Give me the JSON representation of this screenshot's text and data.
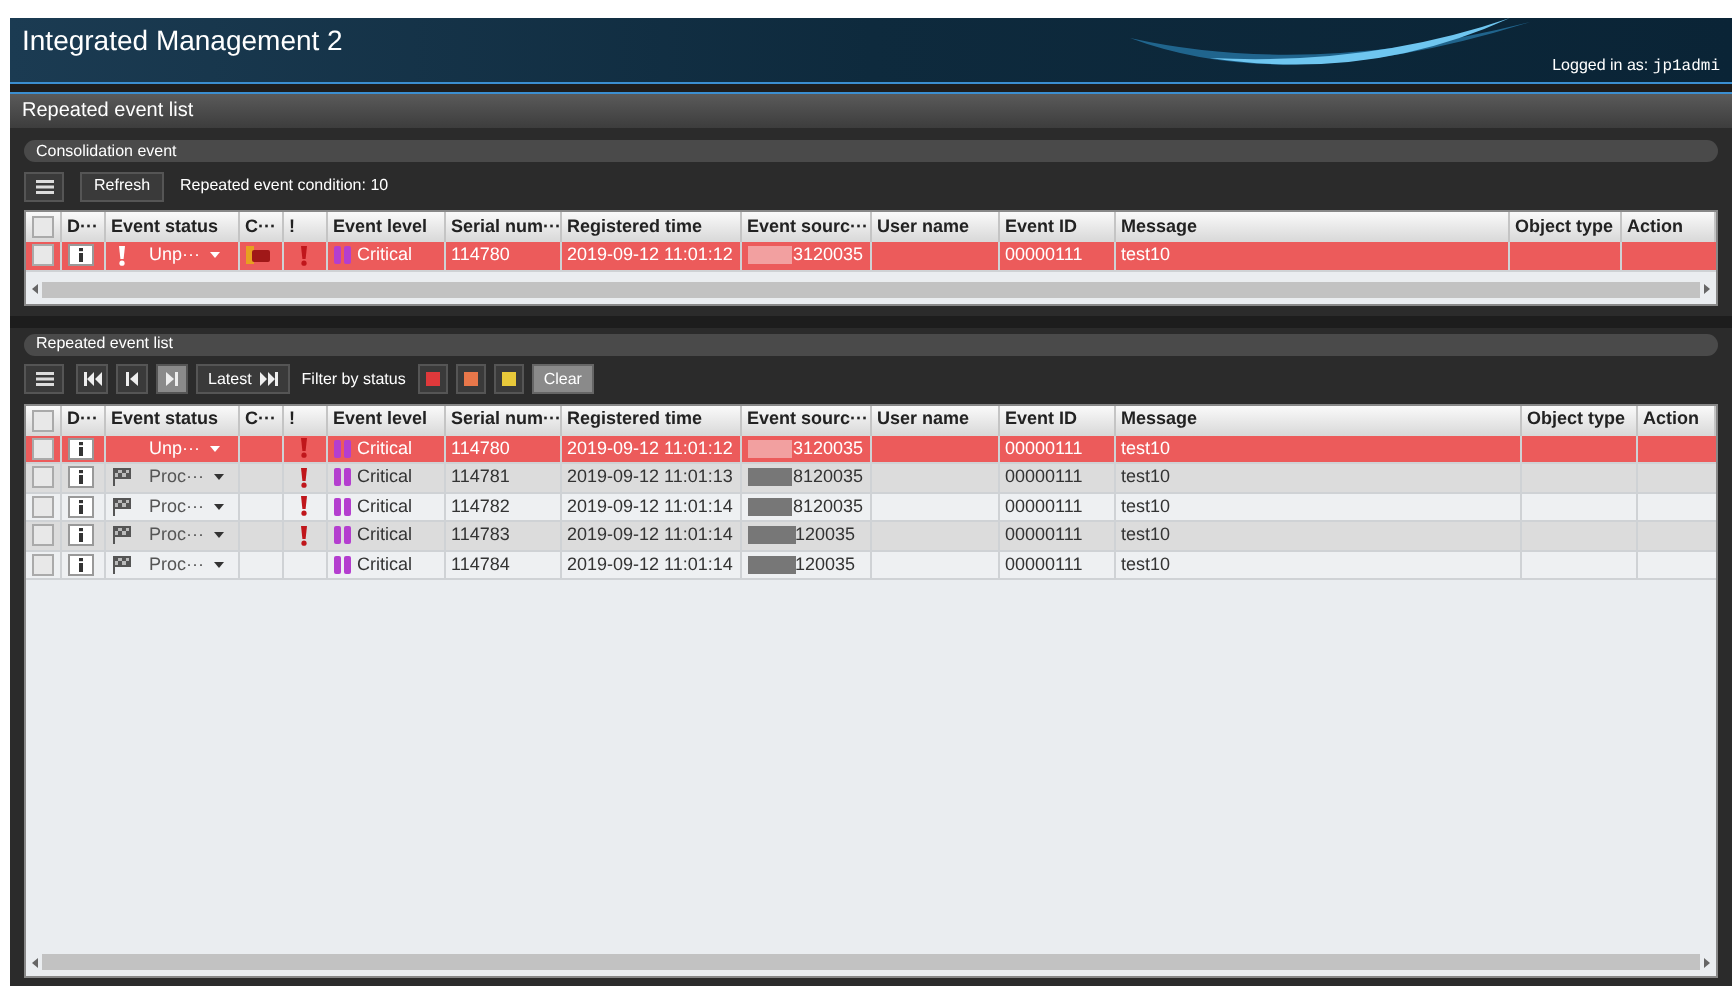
{
  "app_title": "Integrated Management 2",
  "login": {
    "label": "Logged in as:",
    "user": "jp1admi"
  },
  "panel_title": "Repeated event list",
  "consolidation": {
    "title": "Consolidation event",
    "refresh": "Refresh",
    "condition": "Repeated event condition: 10",
    "select_all_checked": false,
    "columns": [
      "D···",
      "Event status",
      "C···",
      "!",
      "Event level",
      "Serial num···",
      "Registered time",
      "Event sourc···",
      "User name",
      "Event ID",
      "Message",
      "Object type",
      "Action"
    ],
    "rows": [
      {
        "selected": true,
        "checked": false,
        "status": "Unp···",
        "alert": true,
        "flagged": false,
        "comment": true,
        "important": true,
        "level": "Critical",
        "serial": "114780",
        "time": "2019-09-12 11:01:12",
        "source": "3120035",
        "event_id": "00000111",
        "message": "test10"
      }
    ]
  },
  "repeated": {
    "title": "Repeated event list",
    "latest": "Latest",
    "filter_label": "Filter by status",
    "clear": "Clear",
    "select_all_checked": false,
    "nav": [
      {
        "kind": "first",
        "disabled": false
      },
      {
        "kind": "prev",
        "disabled": false
      },
      {
        "kind": "next",
        "disabled": true
      }
    ],
    "filters": [
      {
        "color": "#e0393b"
      },
      {
        "color": "#e8774a"
      },
      {
        "color": "#e8c93a"
      }
    ],
    "columns": [
      "D···",
      "Event status",
      "C···",
      "!",
      "Event level",
      "Serial num···",
      "Registered time",
      "Event sourc···",
      "User name",
      "Event ID",
      "Message",
      "Object type",
      "Action"
    ],
    "rows": [
      {
        "selected": true,
        "checked": false,
        "status": "Unp···",
        "alert": false,
        "flagged": false,
        "comment": false,
        "important": true,
        "level": "Critical",
        "serial": "114780",
        "time": "2019-09-12 11:01:12",
        "source": "3120035",
        "event_id": "00000111",
        "message": "test10"
      },
      {
        "selected": false,
        "checked": false,
        "status": "Proc···",
        "alert": false,
        "flagged": true,
        "comment": false,
        "important": true,
        "level": "Critical",
        "serial": "114781",
        "time": "2019-09-12 11:01:13",
        "source": "8120035",
        "event_id": "00000111",
        "message": "test10"
      },
      {
        "selected": false,
        "checked": false,
        "status": "Proc···",
        "alert": false,
        "flagged": true,
        "comment": false,
        "important": true,
        "level": "Critical",
        "serial": "114782",
        "time": "2019-09-12 11:01:14",
        "source": "8120035",
        "event_id": "00000111",
        "message": "test10"
      },
      {
        "selected": false,
        "checked": false,
        "status": "Proc···",
        "alert": false,
        "flagged": true,
        "comment": false,
        "important": true,
        "level": "Critical",
        "serial": "114783",
        "time": "2019-09-12 11:01:14",
        "source": "120035",
        "event_id": "00000111",
        "message": "test10"
      },
      {
        "selected": false,
        "checked": false,
        "status": "Proc···",
        "alert": false,
        "flagged": true,
        "comment": false,
        "important": false,
        "level": "Critical",
        "serial": "114784",
        "time": "2019-09-12 11:01:14",
        "source": "120035",
        "event_id": "00000111",
        "message": "test10"
      }
    ]
  }
}
